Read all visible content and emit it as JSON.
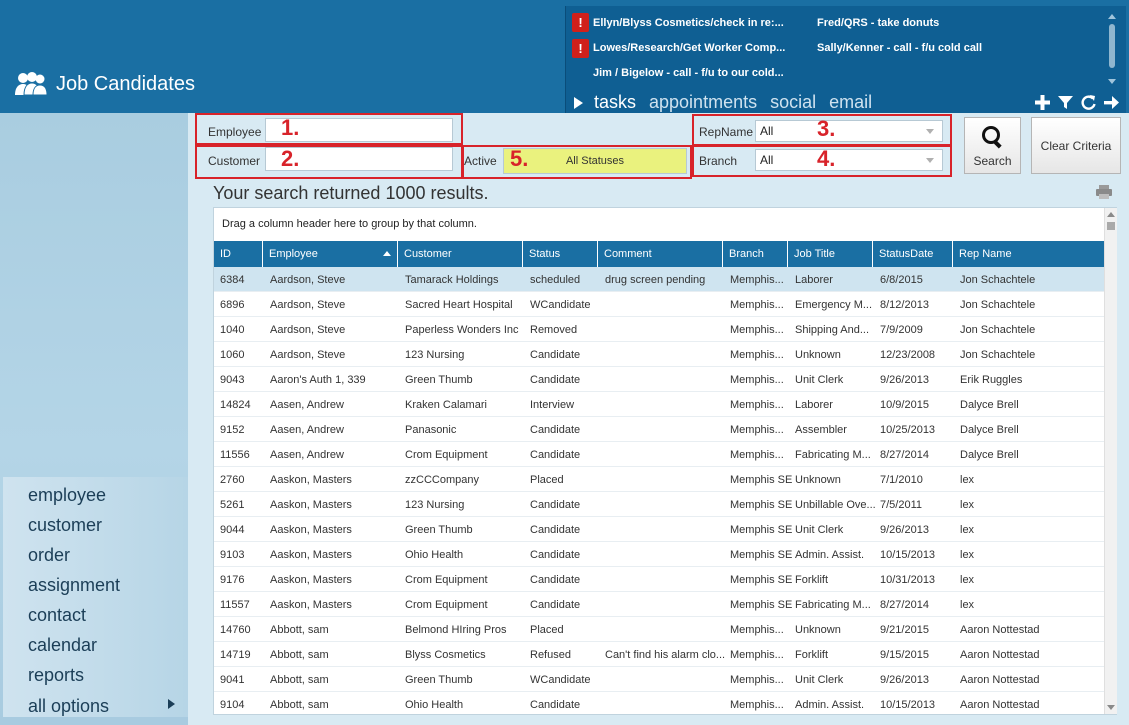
{
  "app": {
    "title": "Job Candidates"
  },
  "tasks": [
    {
      "text": "Ellyn/Blyss Cosmetics/check in re:...",
      "alert": true
    },
    {
      "text": "Fred/QRS - take donuts",
      "alert": false
    },
    {
      "text": "Lowes/Research/Get Worker Comp...",
      "alert": true
    },
    {
      "text": "Sally/Kenner - call - f/u cold call",
      "alert": false
    },
    {
      "text": "Jim / Bigelow - call - f/u to our cold...",
      "alert": false
    }
  ],
  "tabs": [
    "tasks",
    "appointments",
    "social",
    "email"
  ],
  "tool_icons": [
    "plus-icon",
    "filter-icon",
    "refresh-icon",
    "arrow-right-icon"
  ],
  "nav": [
    "employee",
    "customer",
    "order",
    "assignment",
    "contact",
    "calendar",
    "reports",
    "all options"
  ],
  "criteria": {
    "employee_label": "Employee",
    "customer_label": "Customer",
    "active_label": "Active",
    "status_value": "All Statuses",
    "repname_label": "RepName",
    "repname_value": "All",
    "branch_label": "Branch",
    "branch_value": "All",
    "search_button": "Search",
    "clear_button": "Clear Criteria",
    "callouts": [
      "1.",
      "2.",
      "3.",
      "4.",
      "5."
    ]
  },
  "results_text": "Your search returned 1000 results.",
  "grid": {
    "group_hint": "Drag a column header here to group by that column.",
    "columns": [
      "ID",
      "Employee",
      "Customer",
      "Status",
      "Comment",
      "Branch",
      "Job Title",
      "StatusDate",
      "Rep Name"
    ],
    "rows": [
      [
        "6384",
        "Aardson, Steve",
        "Tamarack Holdings",
        "scheduled",
        "drug screen pending",
        "Memphis...",
        "Laborer",
        "6/8/2015",
        "Jon Schachtele"
      ],
      [
        "6896",
        "Aardson, Steve",
        "Sacred Heart Hospital",
        "WCandidate",
        "",
        "Memphis...",
        "Emergency M...",
        "8/12/2013",
        "Jon Schachtele"
      ],
      [
        "1040",
        "Aardson, Steve",
        "Paperless Wonders Inc",
        "Removed",
        "",
        "Memphis...",
        "Shipping And...",
        "7/9/2009",
        "Jon Schachtele"
      ],
      [
        "1060",
        "Aardson, Steve",
        "123 Nursing",
        "Candidate",
        "",
        "Memphis...",
        "Unknown",
        "12/23/2008",
        "Jon Schachtele"
      ],
      [
        "9043",
        "Aaron's Auth 1, 339",
        "Green Thumb",
        "Candidate",
        "",
        "Memphis...",
        "Unit Clerk",
        "9/26/2013",
        "Erik Ruggles"
      ],
      [
        "14824",
        "Aasen, Andrew",
        "Kraken Calamari",
        "Interview",
        "",
        "Memphis...",
        "Laborer",
        "10/9/2015",
        "Dalyce Brell"
      ],
      [
        "9152",
        "Aasen, Andrew",
        "Panasonic",
        "Candidate",
        "",
        "Memphis...",
        "Assembler",
        "10/25/2013",
        "Dalyce Brell"
      ],
      [
        "11556",
        "Aasen, Andrew",
        "Crom Equipment",
        "Candidate",
        "",
        "Memphis...",
        "Fabricating M...",
        "8/27/2014",
        "Dalyce Brell"
      ],
      [
        "2760",
        "Aaskon, Masters",
        "zzCCCompany",
        "Placed",
        "",
        "Memphis SE",
        "Unknown",
        "7/1/2010",
        "lex"
      ],
      [
        "5261",
        "Aaskon, Masters",
        "123 Nursing",
        "Candidate",
        "",
        "Memphis SE",
        "Unbillable Ove...",
        "7/5/2011",
        "lex"
      ],
      [
        "9044",
        "Aaskon, Masters",
        "Green Thumb",
        "Candidate",
        "",
        "Memphis SE",
        "Unit Clerk",
        "9/26/2013",
        "lex"
      ],
      [
        "9103",
        "Aaskon, Masters",
        "Ohio Health",
        "Candidate",
        "",
        "Memphis SE",
        "Admin. Assist.",
        "10/15/2013",
        "lex"
      ],
      [
        "9176",
        "Aaskon, Masters",
        "Crom Equipment",
        "Candidate",
        "",
        "Memphis SE",
        "Forklift",
        "10/31/2013",
        "lex"
      ],
      [
        "11557",
        "Aaskon, Masters",
        "Crom Equipment",
        "Candidate",
        "",
        "Memphis SE",
        "Fabricating M...",
        "8/27/2014",
        "lex"
      ],
      [
        "14760",
        "Abbott, sam",
        "Belmond HIring Pros",
        "Placed",
        "",
        "Memphis...",
        "Unknown",
        "9/21/2015",
        "Aaron Nottestad"
      ],
      [
        "14719",
        "Abbott, sam",
        "Blyss Cosmetics",
        "Refused",
        "Can't find his alarm clo...",
        "Memphis...",
        "Forklift",
        "9/15/2015",
        "Aaron Nottestad"
      ],
      [
        "9041",
        "Abbott, sam",
        "Green Thumb",
        "WCandidate",
        "",
        "Memphis...",
        "Unit Clerk",
        "9/26/2013",
        "Aaron Nottestad"
      ],
      [
        "9104",
        "Abbott, sam",
        "Ohio Health",
        "Candidate",
        "",
        "Memphis...",
        "Admin. Assist.",
        "10/15/2013",
        "Aaron Nottestad"
      ]
    ]
  }
}
